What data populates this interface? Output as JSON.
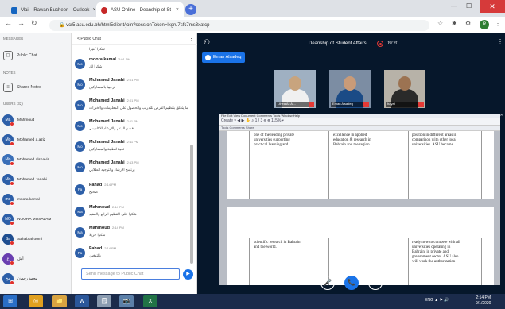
{
  "browser": {
    "tabs": [
      {
        "title": "Mail - Rawan Bucheeri - Outlook",
        "active": false
      },
      {
        "title": "ASU Online - Deanship of St",
        "active": true
      }
    ],
    "new_tab": "+",
    "url": "vcr5.asu.edu.bh/html5client/join?sessionToken=lxgru7sfc7ms3xatcp",
    "window_minimize": "—",
    "window_maximize": "☐",
    "window_close": "✕",
    "profile_initial": "R"
  },
  "sidebar": {
    "messages_header": "MESSAGES",
    "public_chat": "Public Chat",
    "notes_header": "NOTES",
    "shared_notes": "Shared Notes",
    "users_header": "USERS (32)",
    "users": [
      {
        "initials": "Ma",
        "name": "Mahmoud",
        "color": "#2d5fa8"
      },
      {
        "initials": "Mo",
        "name": "Mohamed a.aziz",
        "color": "#2d5fa8"
      },
      {
        "initials": "Mo",
        "name": "Mohamed alsbavir",
        "color": "#3a6fb8"
      },
      {
        "initials": "Mo",
        "name": "Mohamed Janahi",
        "color": "#2d5fa8"
      },
      {
        "initials": "mo",
        "name": "moora kamal",
        "color": "#2d5fa8"
      },
      {
        "initials": "NO",
        "name": "NOORA MUSALAM",
        "color": "#2d5fa8"
      },
      {
        "initials": "Sa",
        "name": "Sahab alroomi",
        "color": "#1f4e90"
      },
      {
        "initials": "ع",
        "name": "أمل",
        "color": "#6a3fb0"
      },
      {
        "initials": "مح",
        "name": "محمد رحمان",
        "color": "#2d5fa8"
      }
    ]
  },
  "chat": {
    "title": "Public Chat",
    "back": "<",
    "more": "⋮",
    "messages": [
      {
        "initials": "",
        "name": "",
        "time": "",
        "text": "شكرا كثيرا"
      },
      {
        "initials": "Mo",
        "name": "moora kamal",
        "time": "2:01 PM",
        "text": "شكرا لك"
      },
      {
        "initials": "Mo",
        "name": "Mohamed Janahi",
        "time": "2:01 PM",
        "text": "ترحيبا بالمشاركين"
      },
      {
        "initials": "Mo",
        "name": "Mohamed Janahi",
        "time": "2:01 PM",
        "text": "ما يتعلق بتنظيم الفرص للتدريب والحصول على المعلومات والخبرات"
      },
      {
        "initials": "Mo",
        "name": "Mohamed Janahi",
        "time": "2:11 PM",
        "text": "قسم الدعم والارشاد الاكاديمي"
      },
      {
        "initials": "Mo",
        "name": "Mohamed Janahi",
        "time": "2:11 PM",
        "text": "تحية للطلبة والمشاركين"
      },
      {
        "initials": "Mo",
        "name": "Mohamed Janahi",
        "time": "2:13 PM",
        "text": "برنامج الارشاد والتوجيه الطلابي"
      },
      {
        "initials": "Fa",
        "name": "Fahad",
        "time": "2:14 PM",
        "text": "صحيح"
      },
      {
        "initials": "Ma",
        "name": "Mahmoud",
        "time": "2:14 PM",
        "text": "شكرا على التنظيم الرائع والمفيد"
      },
      {
        "initials": "Ma",
        "name": "Mahmoud",
        "time": "2:14 PM",
        "text": "شكرا جزيلا"
      },
      {
        "initials": "Fa",
        "name": "Fahad",
        "time": "2:14 PM",
        "text": "بالتوفيق"
      }
    ],
    "input_placeholder": "Send message to Public Chat",
    "send_icon": "▶"
  },
  "main": {
    "user_icon": "⚇",
    "title": "Deanship of Student Affairs",
    "timer": "09:20",
    "more": "⋮",
    "presenter": "Eman Alsadeq",
    "videos": [
      {
        "label": "Lthea Ali Al...",
        "bg": "#9fb0c2",
        "head": "#c8a47e",
        "body": "#f0f0f0"
      },
      {
        "label": "Eman Alsadeq",
        "bg": "#7c8da3",
        "head": "#c99b78",
        "body": "#1b4b86"
      },
      {
        "label": "hayat",
        "bg": "#b7b2a8",
        "head": "#9c7352",
        "body": "#2a2a2a"
      }
    ],
    "expand_icon": "⤢",
    "document": {
      "menu": "File  Edit  View  Document  Comments  Tools  Window  Help",
      "toolbar": "Create ▾   ◀ ▶   ✋  ⌕   1 / 3   ⊖ ⊕  115%  ▾",
      "tools": "Tools   Comments   Share",
      "top_cells": [
        "one of the leading private\nuniversities supporting\npractical learning and",
        "excellence in applied\neducation & research in\nBahrain and the region.",
        "position in different areas in\ncomparison with other local\nuniversities. ASU became"
      ],
      "bottom_cells": [
        "scientific research in Bahrain\nand the world.",
        "",
        "ready now to compete with all\nuniversities operating in\nBahrain, in private and\ngovernment sector. ASU also\nwill work the authorization"
      ]
    },
    "controls": [
      "🎤",
      "📞",
      "⧉"
    ]
  },
  "taskbar": {
    "apps": [
      "⊞",
      "◎",
      "📁",
      "W",
      "🗒",
      "📷",
      "X"
    ],
    "tray": "ENG  ▲ ⚑ 🔊",
    "time": "2:14 PM",
    "date": "9/1/2020"
  }
}
